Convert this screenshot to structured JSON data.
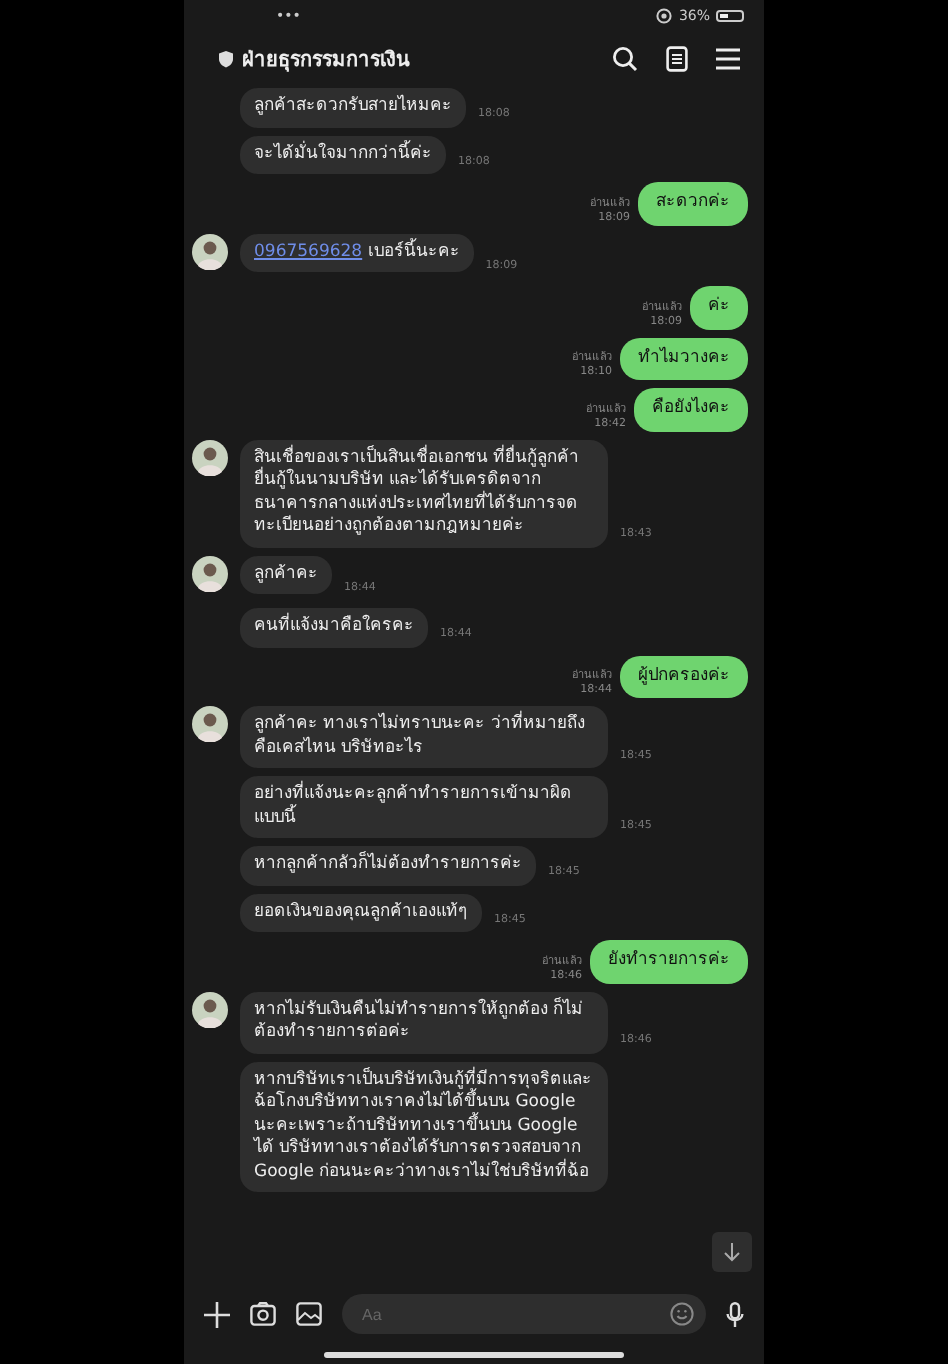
{
  "status_bar": {
    "dots": "•••",
    "battery": "36%"
  },
  "header": {
    "title": "ฝ่ายธุรกรรมการเงิน"
  },
  "messages": [
    {
      "kind": "in",
      "avatar": false,
      "text": "ลูกค้าสะดวกรับสายไหมคะ",
      "time": "18:08"
    },
    {
      "kind": "in",
      "avatar": false,
      "text": "จะได้มั่นใจมากกว่านี้ค่ะ",
      "time": "18:08"
    },
    {
      "kind": "out",
      "read": "อ่านแล้ว",
      "text": "สะดวกค่ะ",
      "time": "18:09"
    },
    {
      "kind": "in",
      "avatar": true,
      "link": "0967569628",
      "text": "เบอร์นี้นะคะ",
      "time": "18:09"
    },
    {
      "kind": "out",
      "read": "อ่านแล้ว",
      "text": "ค่ะ",
      "time": "18:09"
    },
    {
      "kind": "out",
      "read": "อ่านแล้ว",
      "text": "ทำไมวางคะ",
      "time": "18:10"
    },
    {
      "kind": "out",
      "read": "อ่านแล้ว",
      "text": "คือยังไงคะ",
      "time": "18:42"
    },
    {
      "kind": "in",
      "avatar": true,
      "text": "สินเชื่อของเราเป็นสินเชื่อเอกชน ที่ยื่นกู้ลูกค้ายื่นกู้ในนามบริษัท และได้รับเครดิตจากธนาคารกลางแห่งประเทศไทยที่ได้รับการจดทะเบียนอย่างถูกต้องตามกฎหมายค่ะ",
      "time": "18:43"
    },
    {
      "kind": "in",
      "avatar": true,
      "text": "ลูกค้าคะ",
      "time": "18:44"
    },
    {
      "kind": "in",
      "avatar": false,
      "text": "คนที่แจ้งมาคือใครคะ",
      "time": "18:44"
    },
    {
      "kind": "out",
      "read": "อ่านแล้ว",
      "text": "ผู้ปกครองค่ะ",
      "time": "18:44"
    },
    {
      "kind": "in",
      "avatar": true,
      "text": "ลูกค้าคะ ทางเราไม่ทราบนะคะ ว่าที่หมายถึงคือเคสไหน บริษัทอะไร",
      "time": "18:45"
    },
    {
      "kind": "in",
      "avatar": false,
      "text": "อย่างที่แจ้งนะคะลูกค้าทำรายการเข้ามาผิดแบบนี้",
      "time": "18:45"
    },
    {
      "kind": "in",
      "avatar": false,
      "text": "หากลูกค้ากลัวก็ไม่ต้องทำรายการค่ะ",
      "time": "18:45"
    },
    {
      "kind": "in",
      "avatar": false,
      "text": "ยอดเงินของคุณลูกค้าเองแท้ๆ",
      "time": "18:45"
    },
    {
      "kind": "out",
      "read": "อ่านแล้ว",
      "text": "ยังทำรายการค่ะ",
      "time": "18:46"
    },
    {
      "kind": "in",
      "avatar": true,
      "text": "หากไม่รับเงินคืนไม่ทำรายการให้ถูกต้อง ก็ไม่ต้องทำรายการต่อค่ะ",
      "time": "18:46"
    },
    {
      "kind": "in",
      "avatar": false,
      "text": "หากบริษัทเราเป็นบริษัทเงินกู้ที่มีการทุจริตและฉ้อโกงบริษัททางเราคงไม่ได้ขึ้นบน Google นะคะเพราะถ้าบริษัททางเราขึ้นบน Google ได้ บริษัททางเราต้องได้รับการตรวจสอบจาก Google ก่อนนะคะว่าทางเราไม่ใช่บริษัทที่ฉ้อ"
    }
  ],
  "input": {
    "placeholder": "Aa"
  }
}
